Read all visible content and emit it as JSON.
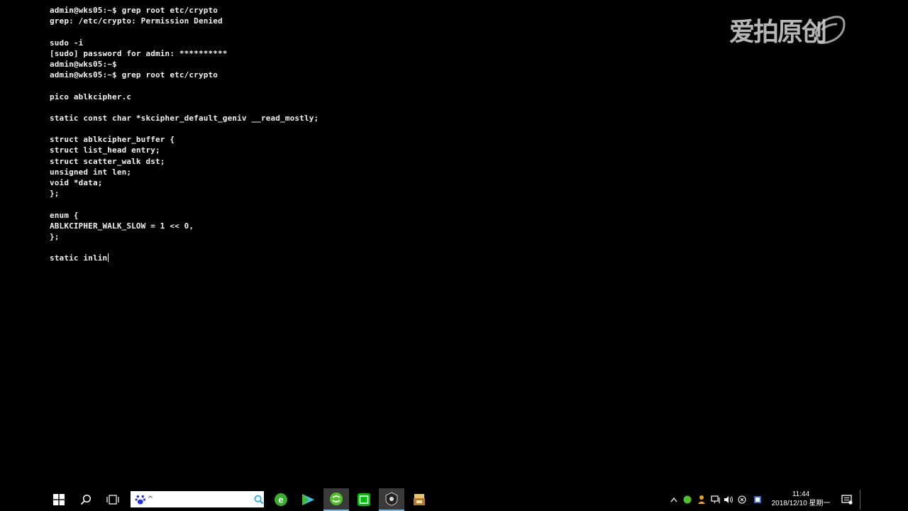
{
  "terminal": {
    "lines": [
      "admin@wks05:~$ grep root etc/crypto",
      "grep: /etc/crypto: Permission Denied",
      "",
      "sudo -i",
      "[sudo] password for admin: **********",
      "admin@wks05:~$",
      "admin@wks05:~$ grep root etc/crypto",
      "",
      "pico ablkcipher.c",
      "",
      "static const char *skcipher_default_geniv __read_mostly;",
      "",
      "struct ablkcipher_buffer {",
      "struct list_head entry;",
      "struct scatter_walk dst;",
      "unsigned int len;",
      "void *data;",
      "};",
      "",
      "enum {",
      "ABLKCIPHER_WALK_SLOW = 1 << 0,",
      "};",
      "",
      "static inlin"
    ]
  },
  "watermark": {
    "text": "爱拍原创"
  },
  "taskbar": {
    "icons": {
      "start": "windows-start-icon",
      "search": "search-icon",
      "taskview": "task-view-icon",
      "search_app": "baidu-paw-icon",
      "search_go": "search-magnifier-icon",
      "apps": [
        "browser-e-icon",
        "media-player-icon",
        "green-app-icon",
        "iqiyi-icon",
        "security-app-icon",
        "game-app-icon"
      ]
    },
    "search": {
      "value": "",
      "caret": "^"
    },
    "clock": {
      "time": "11:44",
      "date": "2018/12/10 星期一"
    },
    "colors": {
      "accent": "#76b9ed",
      "search_icon": "#2aa4f4"
    }
  }
}
